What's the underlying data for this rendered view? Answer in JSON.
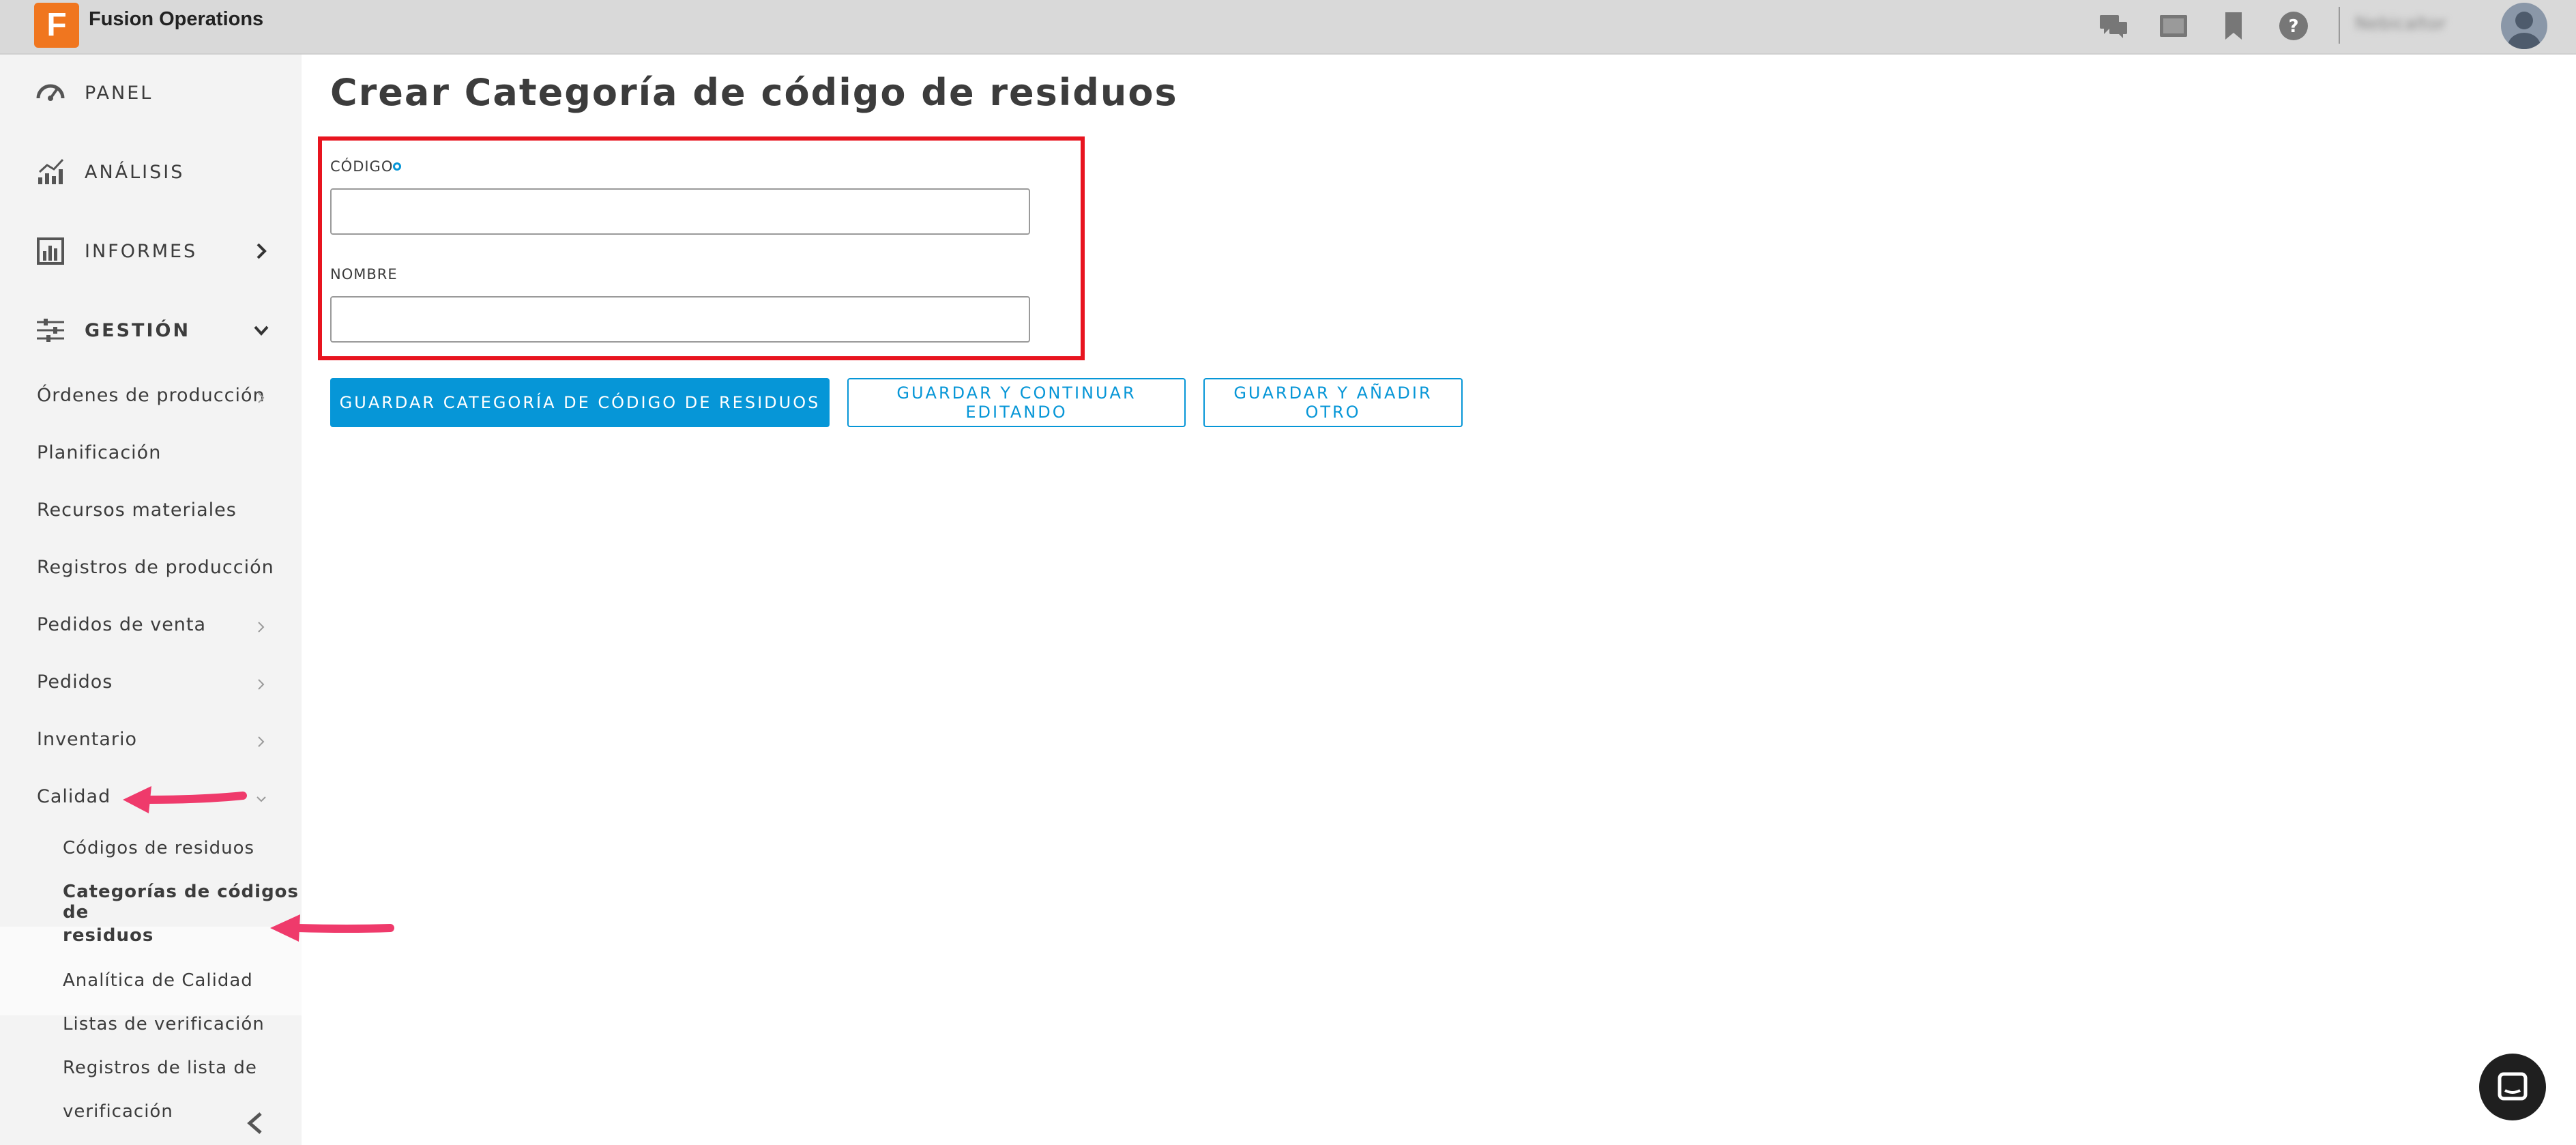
{
  "app": {
    "title": "Fusion Operations",
    "logo_letter": "F",
    "user_name": "Nebicaltor"
  },
  "topbar_icons": [
    "chat-icon",
    "screen-icon",
    "bookmark-icon",
    "help-icon"
  ],
  "sidebar": {
    "main_items": [
      {
        "label": "PANEL",
        "icon": "speedometer-icon"
      },
      {
        "label": "ANÁLISIS",
        "icon": "analytics-icon"
      },
      {
        "label": "INFORMES",
        "icon": "bar-chart-icon"
      },
      {
        "label": "GESTIÓN",
        "icon": "sliders-icon"
      }
    ],
    "sub_items": [
      "Órdenes de producción",
      "Planificación",
      "Recursos materiales",
      "Registros de producción",
      "Pedidos de venta",
      "Pedidos",
      "Inventario",
      "Calidad"
    ],
    "quality_items": [
      "Códigos de residuos",
      "Categorías de códigos de",
      "residuos",
      "Analítica de Calidad",
      "Listas de verificación",
      "Registros de lista de",
      "verificación"
    ]
  },
  "main": {
    "title": "Crear Categoría de código de residuos",
    "fields": [
      {
        "label": "CÓDIGO",
        "value": "",
        "required": true
      },
      {
        "label": "NOMBRE",
        "value": ""
      }
    ],
    "buttons": {
      "save": "GUARDAR CATEGORÍA DE CÓDIGO DE RESIDUOS",
      "save_continue": "GUARDAR Y CONTINUAR EDITANDO",
      "save_add": "GUARDAR Y AÑADIR OTRO"
    }
  },
  "colors": {
    "accent": "#0696d7",
    "highlight": "#e8141f",
    "arrow": "#ef3a6b",
    "logo": "#f0761f"
  }
}
